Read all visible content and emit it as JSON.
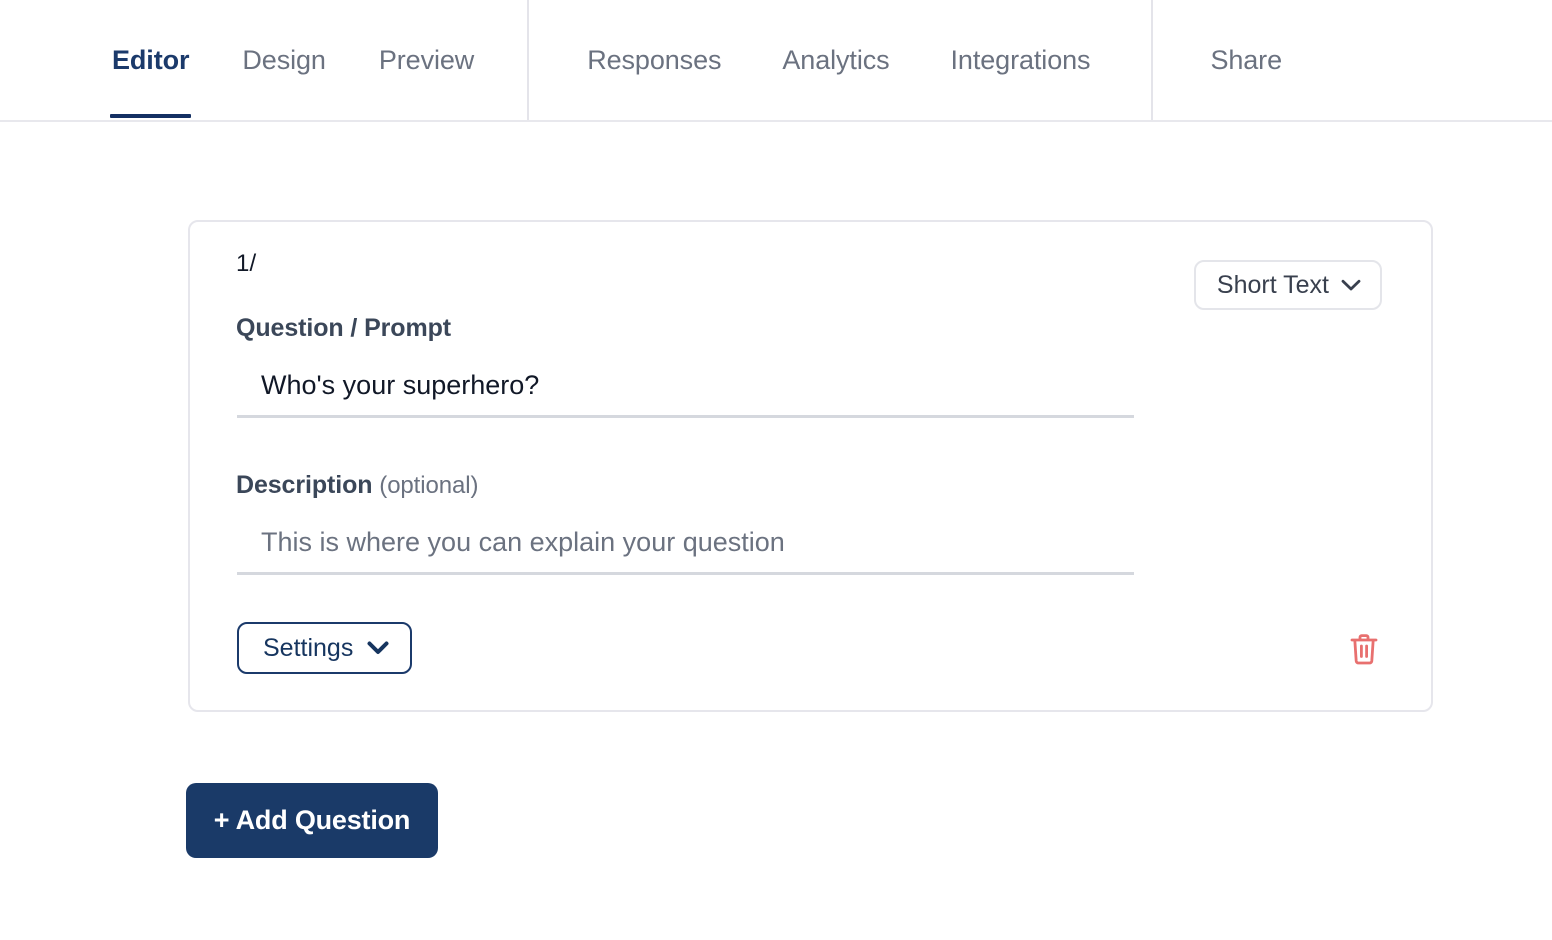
{
  "tabs": {
    "groups": [
      {
        "name": "builder",
        "items": [
          {
            "label": "Editor",
            "active": true
          },
          {
            "label": "Design",
            "active": false
          },
          {
            "label": "Preview",
            "active": false
          }
        ]
      },
      {
        "name": "data",
        "items": [
          {
            "label": "Responses",
            "active": false
          },
          {
            "label": "Analytics",
            "active": false
          },
          {
            "label": "Integrations",
            "active": false
          }
        ]
      },
      {
        "name": "distribute",
        "items": [
          {
            "label": "Share",
            "active": false
          }
        ]
      }
    ]
  },
  "question_card": {
    "number": "1/",
    "type_select": {
      "value": "Short Text",
      "chevron_icon": "chevron-down-icon"
    },
    "question": {
      "label": "Question / Prompt",
      "value": "Who's your superhero?",
      "placeholder": "Who's your superhero?"
    },
    "description": {
      "label": "Description",
      "optional_suffix": "(optional)",
      "value": "",
      "placeholder": "This is where you can explain your question"
    },
    "settings_button": {
      "label": "Settings",
      "chevron_icon": "chevron-down-icon"
    },
    "delete_button": {
      "icon": "trash-icon",
      "color": "#e8706f"
    }
  },
  "add_question_button": {
    "label": "+ Add Question"
  },
  "colors": {
    "accent_navy": "#1a3a68",
    "active_tab_underline": "#143063",
    "inactive_tab_text": "#6b7280",
    "card_border": "#e6e6ec",
    "input_underline": "#d5d8de",
    "danger": "#e8706f"
  }
}
